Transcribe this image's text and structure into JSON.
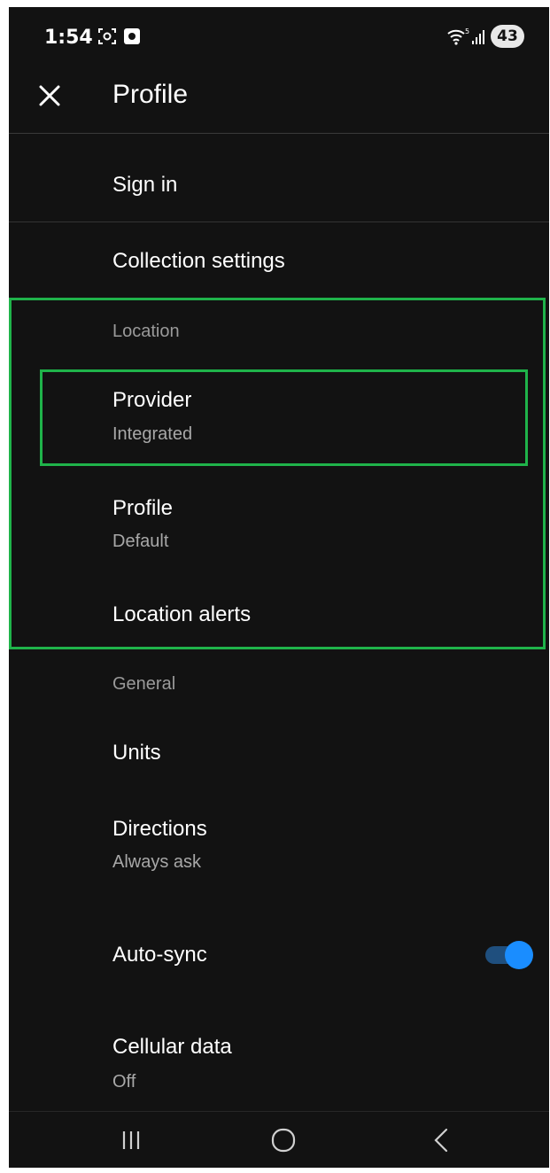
{
  "status_bar": {
    "time": "1:54",
    "battery": "43",
    "icons": [
      "screenshot-icon",
      "notification-icon",
      "wifi-icon",
      "signal-icon"
    ]
  },
  "header": {
    "title": "Profile",
    "close_icon": "close-icon"
  },
  "list": {
    "sign_in": "Sign in",
    "collection_settings": "Collection settings",
    "location_section": "Location",
    "provider": {
      "title": "Provider",
      "value": "Integrated"
    },
    "profile": {
      "title": "Profile",
      "value": "Default"
    },
    "location_alerts": "Location alerts",
    "general_section": "General",
    "units": "Units",
    "directions": {
      "title": "Directions",
      "value": "Always ask"
    },
    "auto_sync": {
      "title": "Auto-sync",
      "enabled": true
    },
    "cellular_data": {
      "title": "Cellular data",
      "value": "Off"
    }
  },
  "colors": {
    "background": "#121212",
    "highlight": "#1fb34a",
    "toggle_accent": "#1a8dff"
  },
  "nav_bar": {
    "icons": [
      "recent-apps-icon",
      "home-icon",
      "back-icon"
    ]
  }
}
